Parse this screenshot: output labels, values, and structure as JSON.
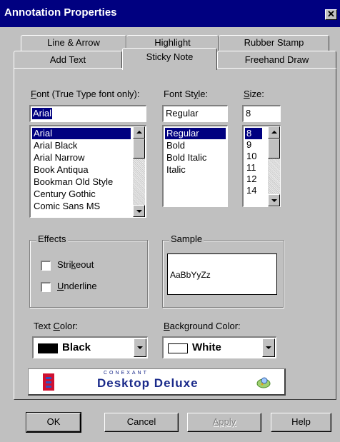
{
  "window": {
    "title": "Annotation Properties",
    "close_glyph": "✕"
  },
  "tabs": [
    {
      "label": "Line & Arrow"
    },
    {
      "label": "Highlight"
    },
    {
      "label": "Rubber Stamp"
    },
    {
      "label": "Add Text"
    },
    {
      "label": "Sticky Note",
      "selected": true
    },
    {
      "label": "Freehand Draw"
    }
  ],
  "font": {
    "label_pre": "",
    "label_mnemonic": "F",
    "label_post": "ont (True Type font only):",
    "value": "Arial",
    "options": [
      "Arial",
      "Arial Black",
      "Arial Narrow",
      "Book Antiqua",
      "Bookman Old Style",
      "Century Gothic",
      "Comic Sans MS"
    ],
    "selected": "Arial"
  },
  "font_style": {
    "label_pre": "Font St",
    "label_mnemonic": "y",
    "label_post": "le:",
    "value": "Regular",
    "options": [
      "Regular",
      "Bold",
      "Bold Italic",
      "Italic"
    ],
    "selected": "Regular"
  },
  "size": {
    "label_pre": "",
    "label_mnemonic": "S",
    "label_post": "ize:",
    "value": "8",
    "options": [
      "8",
      "9",
      "10",
      "11",
      "12",
      "14"
    ],
    "selected": "8"
  },
  "effects": {
    "title": "Effects",
    "strikeout": {
      "pre": "Stri",
      "mn": "k",
      "post": "eout",
      "checked": false
    },
    "underline": {
      "pre": "",
      "mn": "U",
      "post": "nderline",
      "checked": false
    }
  },
  "sample": {
    "title": "Sample",
    "text": "AaBbYyZz"
  },
  "text_color": {
    "label_pre": "Text ",
    "label_mnemonic": "C",
    "label_post": "olor:",
    "value": "Black",
    "swatch": "#000000"
  },
  "background_color": {
    "label_pre": "",
    "label_mnemonic": "B",
    "label_post": "ackground Color:",
    "value": "White",
    "swatch": "#ffffff"
  },
  "banner": {
    "brand_small": "CONEXANT",
    "brand_large": "Desktop Deluxe"
  },
  "buttons": {
    "ok": "OK",
    "cancel": "Cancel",
    "apply": "Apply",
    "help": "Help"
  },
  "colors": {
    "title_bar": "#000080",
    "dialog_face": "#c0c0c0",
    "selection": "#000080",
    "banner_text": "#1a2a8a"
  }
}
